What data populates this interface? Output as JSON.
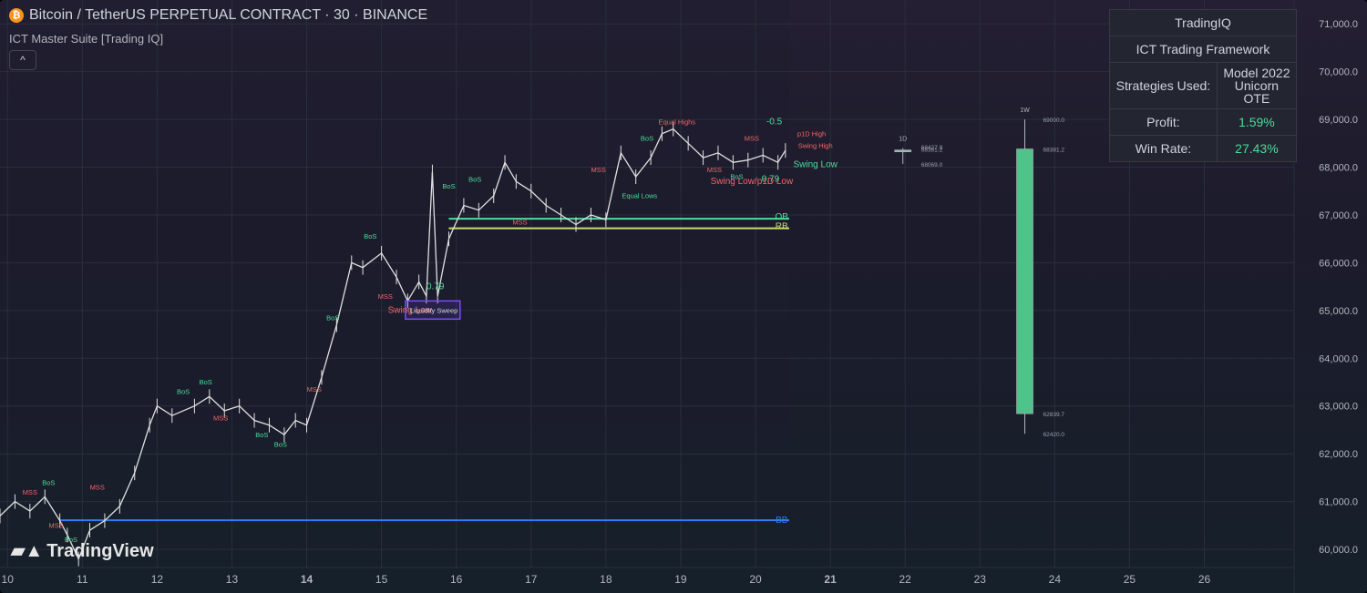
{
  "header": {
    "symbol_title": "Bitcoin / TetherUS PERPETUAL CONTRACT · 30 · BINANCE",
    "indicator_name": "ICT Master Suite [Trading IQ]",
    "collapse_label": "^"
  },
  "stats_table": {
    "title": "TradingIQ",
    "subtitle": "ICT Trading Framework",
    "rows": [
      {
        "label": "Strategies Used:",
        "value": "Model 2022\nUnicorn\nOTE"
      },
      {
        "label": "Profit:",
        "value": "1.59%"
      },
      {
        "label": "Win Rate:",
        "value": "27.43%"
      }
    ]
  },
  "branding": {
    "logo_text": "TradingView",
    "logo_icon": "tradingview-logo-icon"
  },
  "colors": {
    "bull": "#4ade9a",
    "bear": "#f0686a",
    "candle": "#e0e0e0",
    "ob_line": "#4ade9a",
    "rb_line": "#c6e06b",
    "bb_line": "#2f7cf6",
    "liq_box": "#7b4dff",
    "axis_text": "#b2b5be"
  },
  "chart_data": {
    "type": "line",
    "title": "",
    "xlabel": "",
    "ylabel": "",
    "x_ticks": [
      "10",
      "11",
      "12",
      "13",
      "14",
      "15",
      "16",
      "17",
      "18",
      "19",
      "20",
      "21",
      "22",
      "23",
      "24",
      "25",
      "26"
    ],
    "x_tick_bold": [
      "14",
      "21"
    ],
    "y_ticks": [
      60000,
      61000,
      62000,
      63000,
      64000,
      65000,
      66000,
      67000,
      68000,
      69000,
      70000,
      71000
    ],
    "y_tick_labels": [
      "60,000.0",
      "61,000.0",
      "62,000.0",
      "63,000.0",
      "64,000.0",
      "65,000.0",
      "66,000.0",
      "67,000.0",
      "68,000.0",
      "69,000.0",
      "70,000.0",
      "71,000.0"
    ],
    "ylim": [
      59620,
      71500
    ],
    "xlim": [
      9.9,
      27.2
    ],
    "grid": true,
    "series": [
      {
        "x": [
          9.9,
          10.1,
          10.3,
          10.5,
          10.7,
          10.8,
          10.95,
          11.1,
          11.3,
          11.5,
          11.7,
          11.9,
          12.0,
          12.2,
          12.5,
          12.7,
          12.9,
          13.1,
          13.3,
          13.5,
          13.7,
          13.85,
          14.0,
          14.2,
          14.4,
          14.6,
          14.75,
          15.0,
          15.2,
          15.35,
          15.5,
          15.6,
          15.68,
          15.75,
          15.9,
          16.1,
          16.3,
          16.5,
          16.65,
          16.8,
          17.0,
          17.2,
          17.4,
          17.6,
          17.8,
          18.0,
          18.2,
          18.4,
          18.6,
          18.75,
          18.9,
          19.1,
          19.3,
          19.5,
          19.7,
          19.9,
          20.1,
          20.3,
          20.4
        ],
        "values": [
          60700,
          61000,
          60800,
          61100,
          60600,
          60300,
          59800,
          60400,
          60600,
          60900,
          61600,
          62600,
          63000,
          62800,
          63000,
          63200,
          62900,
          63000,
          62700,
          62600,
          62400,
          62700,
          62600,
          63600,
          64700,
          66000,
          65900,
          66200,
          65700,
          65200,
          65600,
          65300,
          67900,
          65300,
          66500,
          67200,
          67100,
          67400,
          68100,
          67700,
          67500,
          67200,
          67000,
          66800,
          67000,
          66900,
          68300,
          67800,
          68200,
          68700,
          68800,
          68500,
          68200,
          68300,
          68100,
          68150,
          68250,
          68100,
          68350
        ]
      }
    ],
    "annotations": [
      {
        "text": "MSS",
        "x": 10.3,
        "y": 61150,
        "color": "bear"
      },
      {
        "text": "BoS",
        "x": 10.55,
        "y": 61350,
        "color": "bull"
      },
      {
        "text": "MSS",
        "x": 10.65,
        "y": 60450,
        "color": "bear"
      },
      {
        "text": "BoS",
        "x": 10.85,
        "y": 60150,
        "color": "bull"
      },
      {
        "text": "MSS",
        "x": 11.2,
        "y": 61250,
        "color": "bear"
      },
      {
        "text": "BoS",
        "x": 12.35,
        "y": 63250,
        "color": "bull"
      },
      {
        "text": "BoS",
        "x": 12.65,
        "y": 63450,
        "color": "bull"
      },
      {
        "text": "MSS",
        "x": 12.85,
        "y": 62700,
        "color": "bear"
      },
      {
        "text": "BoS",
        "x": 13.4,
        "y": 62350,
        "color": "bull"
      },
      {
        "text": "BoS",
        "x": 13.65,
        "y": 62150,
        "color": "bull"
      },
      {
        "text": "MSS",
        "x": 14.1,
        "y": 63300,
        "color": "bear"
      },
      {
        "text": "BoS",
        "x": 14.35,
        "y": 64800,
        "color": "bull"
      },
      {
        "text": "BoS",
        "x": 14.85,
        "y": 66500,
        "color": "bull"
      },
      {
        "text": "MSS",
        "x": 15.05,
        "y": 65250,
        "color": "bear"
      },
      {
        "text": "Swing Low",
        "x": 15.38,
        "y": 64950,
        "color": "bear"
      },
      {
        "text": "Liquidity Sweep",
        "x": 15.7,
        "y": 64950,
        "color": "liquidity"
      },
      {
        "text": "0.79",
        "x": 15.72,
        "y": 65450,
        "color": "bull"
      },
      {
        "text": "BoS",
        "x": 15.9,
        "y": 67550,
        "color": "bull"
      },
      {
        "text": "BoS",
        "x": 16.25,
        "y": 67700,
        "color": "bull"
      },
      {
        "text": "MSS",
        "x": 16.85,
        "y": 66800,
        "color": "bear"
      },
      {
        "text": "MSS",
        "x": 17.9,
        "y": 67900,
        "color": "bear"
      },
      {
        "text": "BoS",
        "x": 18.55,
        "y": 68550,
        "color": "bull"
      },
      {
        "text": "Equal Lows",
        "x": 18.45,
        "y": 67350,
        "color": "bull"
      },
      {
        "text": "Equal Highs",
        "x": 18.95,
        "y": 68900,
        "color": "bear"
      },
      {
        "text": "MSS",
        "x": 19.95,
        "y": 68550,
        "color": "bear"
      },
      {
        "text": "MSS",
        "x": 19.45,
        "y": 67900,
        "color": "bear"
      },
      {
        "text": "BoS",
        "x": 19.75,
        "y": 67750,
        "color": "bull"
      },
      {
        "text": "-0.5",
        "x": 20.25,
        "y": 68900,
        "color": "bull"
      },
      {
        "text": "0.79",
        "x": 20.2,
        "y": 67700,
        "color": "bull"
      },
      {
        "text": "Swing Low/p1D Low",
        "x": 19.95,
        "y": 67650,
        "color": "bear"
      },
      {
        "text": "p1D High",
        "x": 20.75,
        "y": 68650,
        "color": "bear"
      },
      {
        "text": "Swing High",
        "x": 20.8,
        "y": 68400,
        "color": "bear"
      },
      {
        "text": "Swing Low",
        "x": 20.8,
        "y": 68000,
        "color": "bull"
      },
      {
        "text": "OB",
        "x": 20.35,
        "y": 66900,
        "color": "ob"
      },
      {
        "text": "RB",
        "x": 20.35,
        "y": 66700,
        "color": "rb"
      },
      {
        "text": "BB",
        "x": 20.35,
        "y": 60550,
        "color": "bb"
      }
    ],
    "levels": [
      {
        "name": "OB",
        "y": 66920,
        "color": "ob_line"
      },
      {
        "name": "RB",
        "y": 66720,
        "color": "rb_line"
      },
      {
        "name": "BB",
        "y": 60610,
        "color": "bb_line"
      }
    ],
    "htf_candles": [
      {
        "label": "1D",
        "x": 21.97,
        "open": 68330,
        "close": 68360,
        "high": 68400,
        "low": 68069,
        "price_labels": [
          "68427.9",
          "68381.2",
          "68069.0"
        ]
      },
      {
        "label": "1W",
        "x": 23.6,
        "open": 62839.7,
        "close": 68381.2,
        "high": 69000,
        "low": 62420,
        "price_labels": [
          "69000.0",
          "68381.2",
          "62839.7",
          "62420.0"
        ]
      }
    ]
  }
}
